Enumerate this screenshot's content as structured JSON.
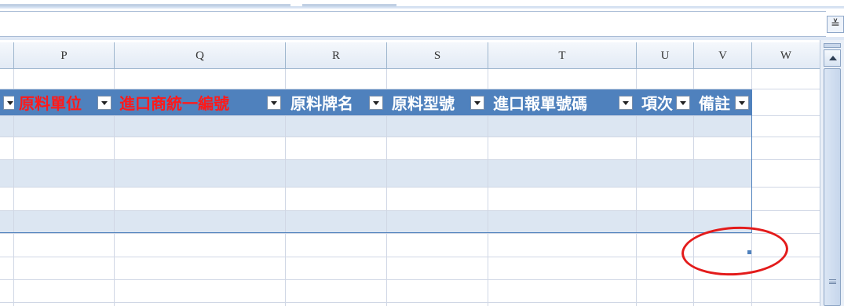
{
  "formula_bar": {
    "value": ""
  },
  "expand_button": {
    "glyph": "≚"
  },
  "columns": [
    "P",
    "Q",
    "R",
    "S",
    "T",
    "U",
    "V",
    "W"
  ],
  "table_headers": [
    {
      "label": "原料單位",
      "color": "#ff1a1a"
    },
    {
      "label": "進口商統一編號",
      "color": "#ff1a1a"
    },
    {
      "label": "原料牌名",
      "color": "#ffffff"
    },
    {
      "label": "原料型號",
      "color": "#ffffff"
    },
    {
      "label": "進口報單號碼",
      "color": "#ffffff"
    },
    {
      "label": "項次",
      "color": "#ffffff"
    },
    {
      "label": "備註",
      "color": "#ffffff"
    }
  ],
  "colors": {
    "table_header_bg": "#4f81bd",
    "band_bg": "#dce6f2",
    "annotation": "#e31b1b"
  }
}
